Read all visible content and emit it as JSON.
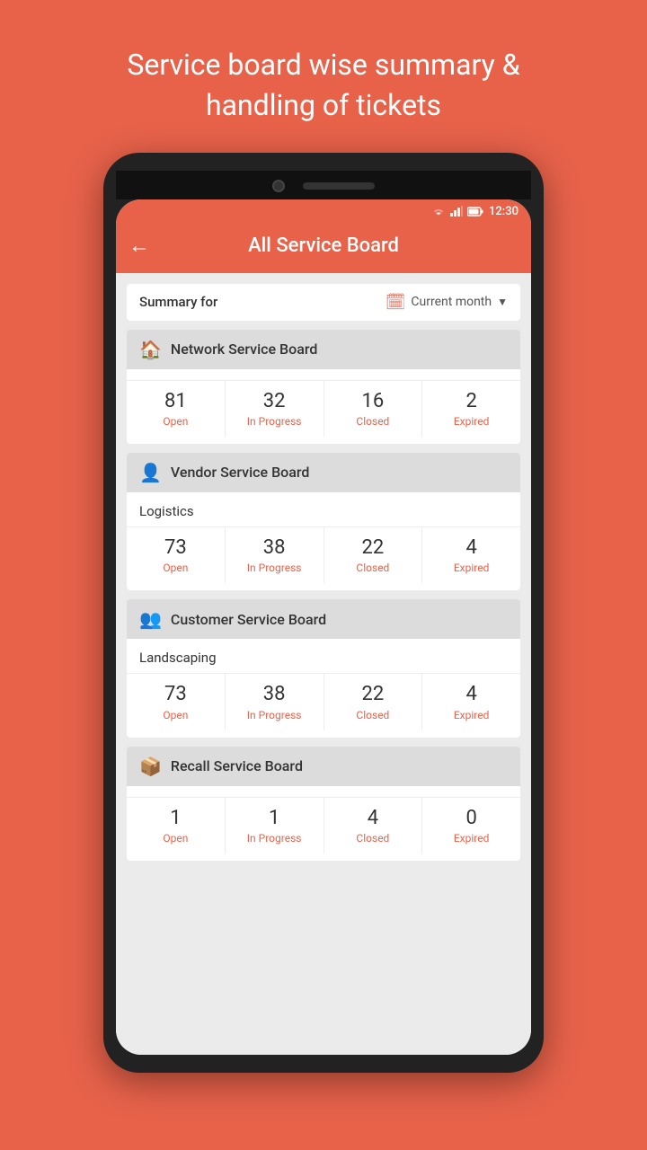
{
  "page": {
    "bg_title_line1": "Service board wise summary &",
    "bg_title_line2": "handling of tickets"
  },
  "status_bar": {
    "time": "12:30"
  },
  "header": {
    "title": "All Service Board",
    "back_label": "←"
  },
  "filter": {
    "label": "Summary for",
    "option": "Current month"
  },
  "boards": [
    {
      "id": "network",
      "icon": "🏠",
      "name": "Network Service Board",
      "subtitle": null,
      "stats": [
        {
          "number": "81",
          "label": "Open"
        },
        {
          "number": "32",
          "label": "In Progress"
        },
        {
          "number": "16",
          "label": "Closed"
        },
        {
          "number": "2",
          "label": "Expired"
        }
      ]
    },
    {
      "id": "vendor",
      "icon": "👤",
      "name": "Vendor Service Board",
      "subtitle": "Logistics",
      "stats": [
        {
          "number": "73",
          "label": "Open"
        },
        {
          "number": "38",
          "label": "In Progress"
        },
        {
          "number": "22",
          "label": "Closed"
        },
        {
          "number": "4",
          "label": "Expired"
        }
      ]
    },
    {
      "id": "customer",
      "icon": "👥",
      "name": "Customer Service Board",
      "subtitle": "Landscaping",
      "stats": [
        {
          "number": "73",
          "label": "Open"
        },
        {
          "number": "38",
          "label": "In Progress"
        },
        {
          "number": "22",
          "label": "Closed"
        },
        {
          "number": "4",
          "label": "Expired"
        }
      ]
    },
    {
      "id": "recall",
      "icon": "📦",
      "name": "Recall Service Board",
      "subtitle": null,
      "stats": [
        {
          "number": "1",
          "label": "Open"
        },
        {
          "number": "1",
          "label": "In Progress"
        },
        {
          "number": "4",
          "label": "Closed"
        },
        {
          "number": "0",
          "label": "Expired"
        }
      ]
    }
  ]
}
